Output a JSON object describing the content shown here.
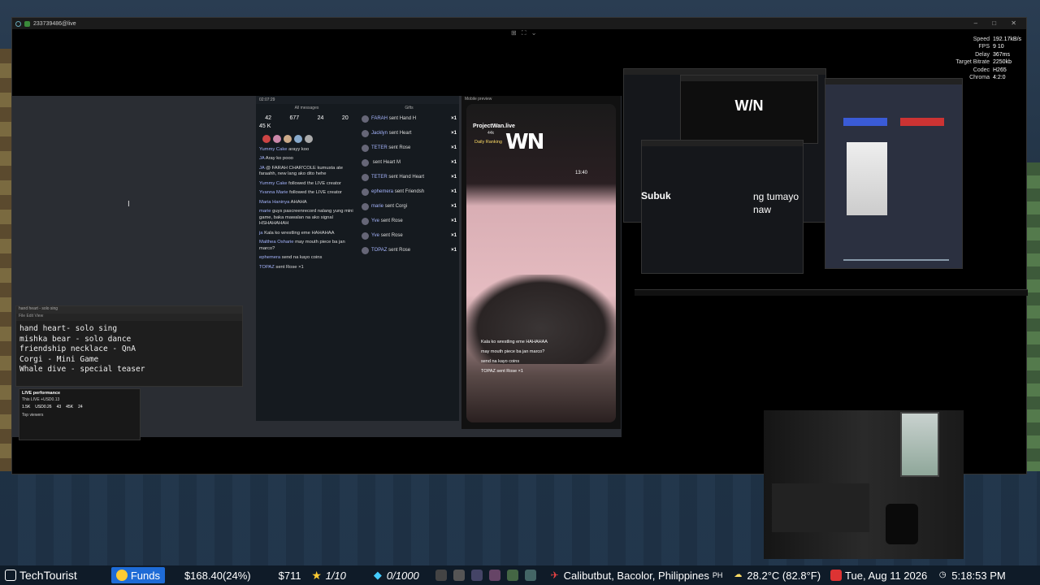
{
  "rd_window": {
    "title": "233739486@live",
    "controls": "– □ ✕",
    "toolbar": "⊞ ⛶ ⌄"
  },
  "stream_stats": [
    {
      "k": "Speed",
      "v": "192.17kB/s"
    },
    {
      "k": "FPS",
      "v": "9 10"
    },
    {
      "k": "Delay",
      "v": "367ms"
    },
    {
      "k": "Target Bitrate",
      "v": "2250kb"
    },
    {
      "k": "Codec",
      "v": "H265"
    },
    {
      "k": "Chroma",
      "v": "4:2:0"
    }
  ],
  "notepad": {
    "title": "hand heart - solo sing",
    "menu": "File  Edit  View",
    "lines": [
      "hand heart- solo sing",
      "mishka bear - solo dance",
      "friendship necklace - QnA",
      "Corgi - Mini Game",
      "Whale dive - special teaser"
    ]
  },
  "live_perf": {
    "title": "LIVE performance",
    "subtitle": "This LIVE +USD0.13",
    "vals": [
      "1.5K",
      "USD0.26",
      "43",
      "45K",
      "24"
    ],
    "footer": "Top viewers"
  },
  "tiktok": {
    "timer": "02:07:29",
    "col1_title": "All messages",
    "col2_title": "Gifts",
    "counts": [
      "42",
      "677",
      "24",
      "20"
    ],
    "likes": "45 K",
    "col1": [
      {
        "u": "Yummy Cake",
        "t": "arayy koo"
      },
      {
        "u": "JA",
        "t": "Aray ko pooo"
      },
      {
        "u": "JA",
        "t": "@ FARAH CHAR'COLE kumusta ate faraahh, new lang ako dito hehe"
      },
      {
        "u": "Yummy Cake",
        "t": "followed the LIVE creator"
      },
      {
        "u": "Yvanna Marie",
        "t": "followed the LIVE creator"
      },
      {
        "u": "Maria Haninya",
        "t": "AHAHA"
      },
      {
        "u": "marie",
        "t": "guys pascreenrecord nalang yung mini game, baka mawalan na ako signal HSHAHAHAH"
      },
      {
        "u": "ja",
        "t": "Kala ko wrestling eme HAHAHAA"
      },
      {
        "u": "Malthea Osharie",
        "t": "may mouth piece ba jan marco?"
      },
      {
        "u": "ephemera",
        "t": "send na kayo coins"
      },
      {
        "u": "TOPAZ",
        "t": "sent Rose ×1"
      }
    ],
    "gifts": [
      {
        "u": "FARAH",
        "t": "sent Hand H",
        "x": "×1"
      },
      {
        "u": "Jacklyn",
        "t": "sent Heart",
        "x": "×1"
      },
      {
        "u": "TETER",
        "t": "sent Rose",
        "x": "×1"
      },
      {
        "u": "",
        "t": "sent Heart M",
        "x": "×1"
      },
      {
        "u": "TETER",
        "t": "sent Hand Heart",
        "x": "×1"
      },
      {
        "u": "ephemera",
        "t": "sent Friendsh",
        "x": "×1"
      },
      {
        "u": "marie",
        "t": "sent Corgi",
        "x": "×1"
      },
      {
        "u": "Yve",
        "t": "sent Rose",
        "x": "×1"
      },
      {
        "u": "Yve",
        "t": "sent Rose",
        "x": "×1"
      },
      {
        "u": "TOPAZ",
        "t": "sent Rose",
        "x": "×1"
      }
    ]
  },
  "phone": {
    "title": "Mobile preview",
    "account": "ProjectWan.live",
    "likes": "44k",
    "ranking": "Daily Ranking",
    "logo": "WN",
    "clock": "13:40",
    "comments": [
      "Kala ko wrestling eme HAHAHAA",
      "may mouth piece ba jan marco?",
      "send na kayo coins",
      "TOPAZ sent Rose ×1"
    ]
  },
  "right_text": {
    "a": "Subuk",
    "b": "ng tumayo",
    "c": "naw"
  },
  "bottom": {
    "channel": "TechTourist",
    "funds": "Funds",
    "amount": "$168.40(24%)",
    "dollars": "$711",
    "ratio": "1/10",
    "diamonds": "0/1000",
    "location": "Calibutbut, Bacolor, Philippines",
    "loc_cc": "PH",
    "temp": "28.2°C (82.8°F)",
    "date": "Tue, Aug 11 2026",
    "time": "5:18:53 PM"
  }
}
